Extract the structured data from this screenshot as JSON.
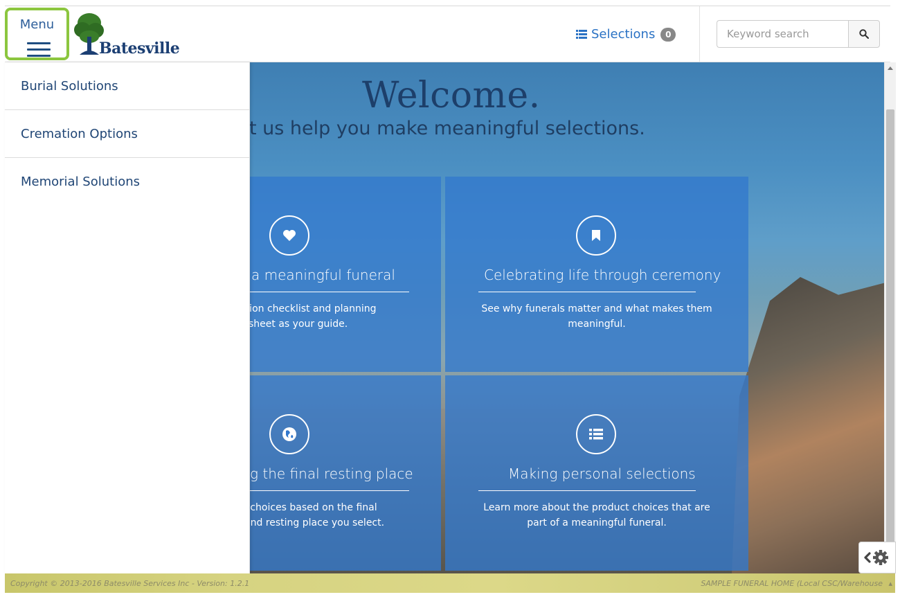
{
  "header": {
    "menu_label": "Menu",
    "brand": "Batesville",
    "selections_label": "Selections",
    "selections_count": "0",
    "search_placeholder": "Keyword search"
  },
  "side_menu": {
    "items": [
      {
        "label": "Burial Solutions"
      },
      {
        "label": "Cremation Options"
      },
      {
        "label": "Memorial Solutions"
      }
    ]
  },
  "hero": {
    "title": "Welcome.",
    "subtitle": "t us help you make meaningful selections."
  },
  "tiles": [
    {
      "icon": "heart-icon",
      "title": "a meaningful funeral",
      "desc_lines": [
        "ision checklist and planning",
        "sheet as your guide."
      ]
    },
    {
      "icon": "bookmark-icon",
      "title": "Celebrating life through ceremony",
      "desc_lines": [
        "See why funerals matter and what makes them",
        "meaningful."
      ]
    },
    {
      "icon": "globe-icon",
      "title": "g the final resting place",
      "desc_lines": [
        "l choices based on the final",
        "and resting place you select."
      ]
    },
    {
      "icon": "list-icon",
      "title": "Making personal selections",
      "desc_lines": [
        "Learn more about the product choices that are",
        "part of a meaningful funeral."
      ]
    }
  ],
  "footer": {
    "copyright": "Copyright © 2013-2016 Batesville Services Inc - Version: 1.2.1",
    "home_label": "SAMPLE FUNERAL HOME (Local CSC/Warehouse"
  },
  "colors": {
    "menu_highlight": "#8cc63f",
    "brand_navy": "#1c3f73",
    "link_blue": "#2a72c4",
    "tile_blue": "#3278cd",
    "footer_olive": "#d6d381"
  }
}
